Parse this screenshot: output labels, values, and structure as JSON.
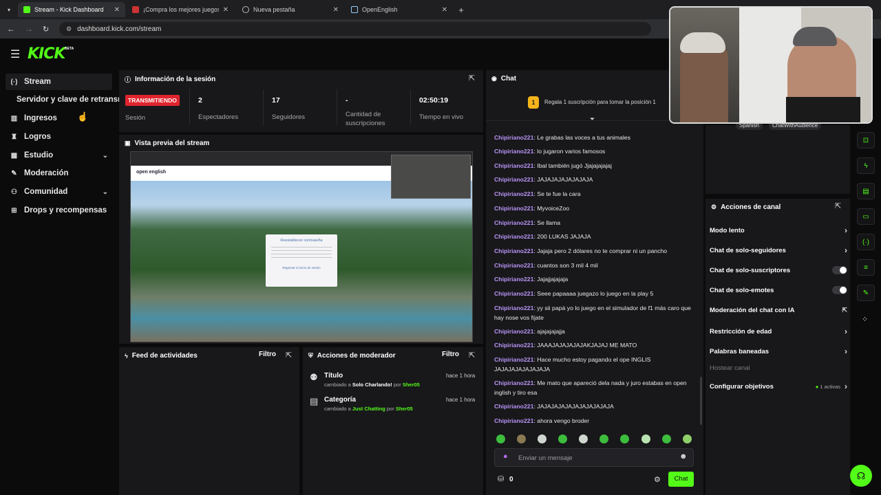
{
  "browser": {
    "tabs": [
      {
        "title": "Stream - Kick Dashboard",
        "active": true
      },
      {
        "title": "¡Compra los mejores juegos m"
      },
      {
        "title": "Nueva pestaña"
      },
      {
        "title": "OpenEnglish"
      }
    ],
    "url": "dashboard.kick.com/stream"
  },
  "brand": {
    "logo": "KICK",
    "badge": "BETA",
    "accent": "#53fc18"
  },
  "sidebar": {
    "items": [
      {
        "label": "Stream",
        "icon": "broadcast-icon"
      },
      {
        "label": "Servidor y clave de retransm"
      },
      {
        "label": "Ingresos",
        "icon": "chart-icon"
      },
      {
        "label": "Logros",
        "icon": "trophy-icon"
      },
      {
        "label": "Estudio",
        "icon": "studio-icon"
      },
      {
        "label": "Moderación",
        "icon": "wrench-icon"
      },
      {
        "label": "Comunidad",
        "icon": "community-icon"
      },
      {
        "label": "Drops y recompensas",
        "icon": "gift-icon"
      }
    ]
  },
  "session": {
    "title": "Información de la sesión",
    "status": "TRANSMITIENDO",
    "status_label": "Sesión",
    "stats": [
      {
        "value": "2",
        "label": "Espectadores"
      },
      {
        "value": "17",
        "label": "Seguidores"
      },
      {
        "value": "-",
        "label": "Cantidad de suscripciones"
      },
      {
        "value": "02:50:19",
        "label": "Tiempo en vivo"
      }
    ]
  },
  "preview": {
    "title": "Vista previa del stream",
    "page_logo": "open english",
    "dialog_title": "Reestablecer contraseña",
    "dialog_link": "Regresar al inicio de sesión"
  },
  "feed": {
    "title": "Feed de actividades",
    "filter": "Filtro"
  },
  "modactions": {
    "title": "Acciones de moderador",
    "filter": "Filtro",
    "items": [
      {
        "title": "Título",
        "time": "hace 1 hora",
        "prefix": "cambiado a",
        "value": "Solo Charlando!",
        "by": "por",
        "user": "Sher05"
      },
      {
        "title": "Categoría",
        "time": "hace 1 hora",
        "prefix": "cambiado a",
        "value": "Just Chatting",
        "by": "por",
        "user": "Sher05"
      }
    ]
  },
  "chat": {
    "title": "Chat",
    "gift_rank": "1",
    "gift_text": "Regala 1 suscripción para tomar la posición 1",
    "messages": [
      {
        "user": "Chipiriano221",
        "text": "Le grabas las voces a tus animales"
      },
      {
        "user": "Chipiriano221",
        "text": "lo jugaron varios famosos"
      },
      {
        "user": "Chipiriano221",
        "text": "Ibal también jugó Jjajajajajaj"
      },
      {
        "user": "Chipiriano221",
        "text": "JAJAJAJAJAJAJAJA"
      },
      {
        "user": "Chipiriano221",
        "text": "Se te fue la cara"
      },
      {
        "user": "Chipiriano221",
        "text": "MyvoiceZoo"
      },
      {
        "user": "Chipiriano221",
        "text": "Se llama"
      },
      {
        "user": "Chipiriano221",
        "text": "200 LUKAS JAJAJA"
      },
      {
        "user": "Chipiriano221",
        "text": "Jajaja pero 2 dólares no te comprar ni un pancho"
      },
      {
        "user": "Chipiriano221",
        "text": "cuantos son 3 mil 4 mil"
      },
      {
        "user": "Chipiriano221",
        "text": "Jajajjajajaja"
      },
      {
        "user": "Chipiriano221",
        "text": "Seee papaaaa juegazo lo juego en la play 5"
      },
      {
        "user": "Chipiriano221",
        "text": "yy sii papá yo lo juego en el simulador de f1 más caro que hay nose vos fijate"
      },
      {
        "user": "Chipiriano221",
        "text": "ajajajajajja"
      },
      {
        "user": "Chipiriano221",
        "text": "JAAAJAJAJAJAJAKJAJAJ ME MATO"
      },
      {
        "user": "Chipiriano221",
        "text": "Hace mucho estoy pagando el ope INGLIS JAJAJAJAJAJAJAJA"
      },
      {
        "user": "Chipiriano221",
        "text": "Me mato que apareció dela nada y juro estabas en open inglish y tiro esa"
      },
      {
        "user": "Chipiriano221",
        "text": "JAJAJAJAJAJAJAJAJAJAJA"
      },
      {
        "user": "Chipiriano221",
        "text": "ahora vengo broder"
      }
    ],
    "input_placeholder": "Enviar un mensaje",
    "count": "0",
    "send": "Chat"
  },
  "channel_actions": {
    "title": "Acciones de canal",
    "items": [
      {
        "label": "Modo lento",
        "control": "arrow"
      },
      {
        "label": "Chat de solo-seguidores",
        "control": "arrow"
      },
      {
        "label": "Chat de solo-suscriptores",
        "control": "toggle"
      },
      {
        "label": "Chat de solo-emotes",
        "control": "toggle"
      },
      {
        "label": "Moderación del chat con IA",
        "control": "external"
      },
      {
        "label": "Restricción de edad",
        "control": "arrow"
      },
      {
        "label": "Palabras baneadas",
        "control": "arrow"
      },
      {
        "label": "Hostear canal",
        "control": "none",
        "disabled": true
      },
      {
        "label": "Configurar objetivos",
        "control": "arrow",
        "badge": "1 activas"
      }
    ]
  },
  "webcam_tags": [
    "Spanish",
    "ChatWithAudience"
  ]
}
